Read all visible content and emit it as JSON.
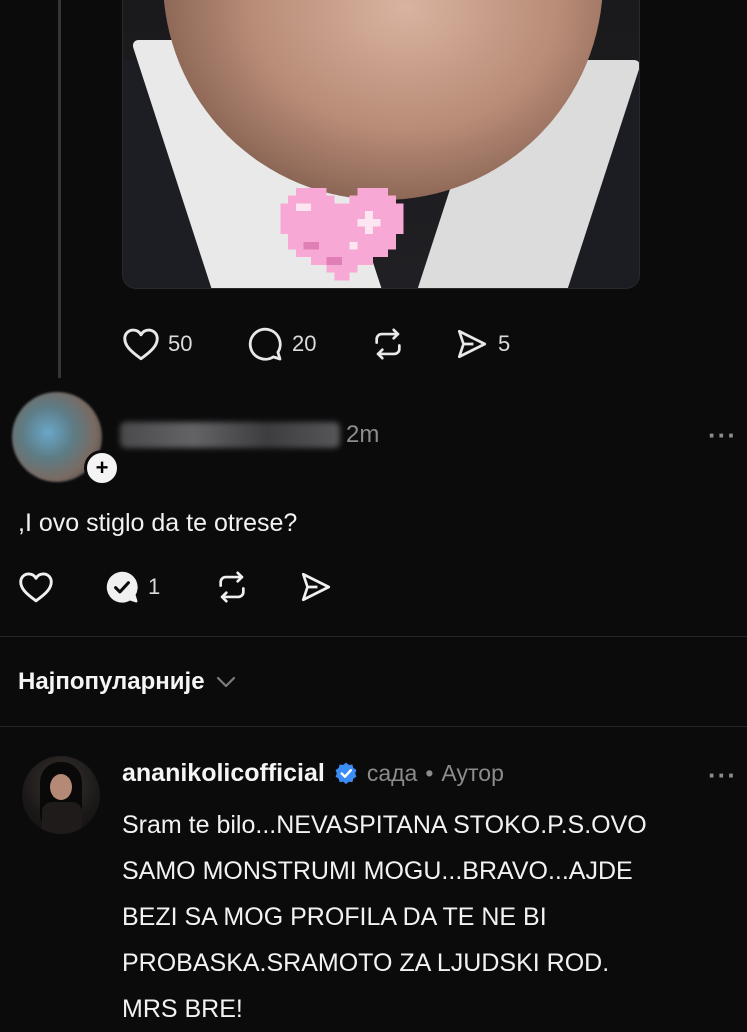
{
  "top_post": {
    "actions": {
      "likes": "50",
      "comments": "20",
      "shares": "5"
    }
  },
  "comment": {
    "time": "2m",
    "text": ",I ovo stiglo da te otrese?",
    "reply_count": "1",
    "more": "···"
  },
  "sort": {
    "label": "Најпопуларније"
  },
  "reply": {
    "username": "ananikolicofficial",
    "time": "сада",
    "separator": "•",
    "author_tag": "Аутор",
    "more": "···",
    "lines": [
      "Sram te bilo...NEVASPITANA STOKO.P.S.OVO",
      "SAMO MONSTRUMI MOGU...BRAVO...AJDE",
      "BEZI SA MOG PROFILA DA TE NE BI",
      "PROBASKA.SRAMOTO ZA LJUDSKI ROD.",
      "MRS BRE!"
    ]
  },
  "colors": {
    "background": "#0b0b0c",
    "verified": "#3b8cf5",
    "heart_sticker": "#f7a8d4"
  }
}
